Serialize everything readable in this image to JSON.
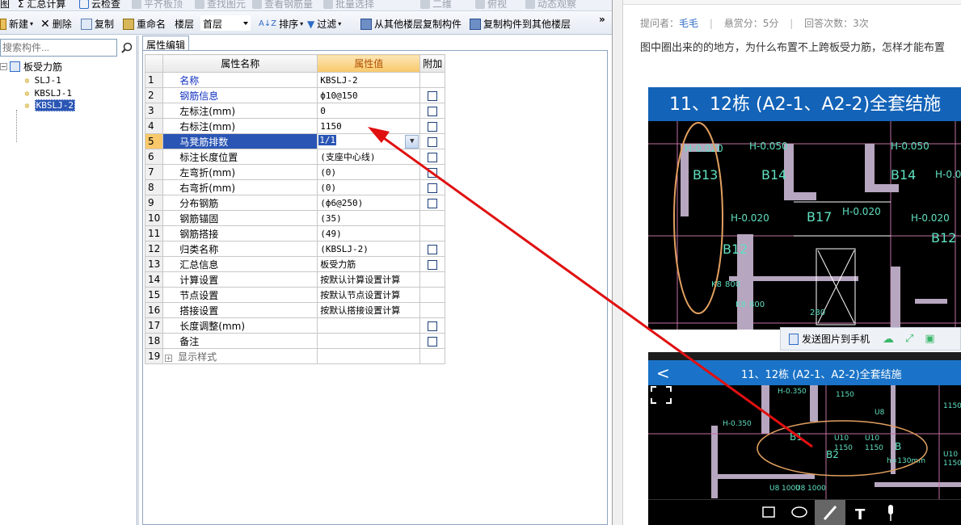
{
  "toolbar_row1": {
    "items": [
      "图",
      "Σ 汇总计算",
      "云检查",
      "平齐板顶",
      "查找图元",
      "查看钢筋量",
      "批量选择",
      "二维",
      "俯视",
      "动态观察"
    ]
  },
  "toolbar_row2": {
    "new_label": "新建",
    "delete_label": "删除",
    "copy_label": "复制",
    "rename_label": "重命名",
    "floor_label": "楼层",
    "floor_value": "首层",
    "sort_label": "排序",
    "filter_label": "过滤",
    "copy_from_label": "从其他楼层复制构件",
    "copy_to_label": "复制构件到其他楼层",
    "more": "»"
  },
  "left_panel": {
    "search_placeholder": "搜索构件...",
    "root_label": "板受力筋",
    "items": [
      "SLJ-1",
      "KBSLJ-1",
      "KBSLJ-2"
    ]
  },
  "property_panel": {
    "tab_label": "属性编辑",
    "headers": {
      "name": "属性名称",
      "value": "属性值",
      "extra": "附加"
    },
    "rows": [
      {
        "idx": "1",
        "name": "名称",
        "value": "KBSLJ-2"
      },
      {
        "idx": "2",
        "name": "钢筋信息",
        "value": "ф10@150"
      },
      {
        "idx": "3",
        "name": "左标注(mm)",
        "value": "0"
      },
      {
        "idx": "4",
        "name": "右标注(mm)",
        "value": "1150"
      },
      {
        "idx": "5",
        "name": "马凳筋排数",
        "value": "1/1"
      },
      {
        "idx": "6",
        "name": "标注长度位置",
        "value": "(支座中心线)"
      },
      {
        "idx": "7",
        "name": "左弯折(mm)",
        "value": "(0)"
      },
      {
        "idx": "8",
        "name": "右弯折(mm)",
        "value": "(0)"
      },
      {
        "idx": "9",
        "name": "分布钢筋",
        "value": "(ф6@250)"
      },
      {
        "idx": "10",
        "name": "钢筋锚固",
        "value": "(35)"
      },
      {
        "idx": "11",
        "name": "钢筋搭接",
        "value": "(49)"
      },
      {
        "idx": "12",
        "name": "归类名称",
        "value": "(KBSLJ-2)"
      },
      {
        "idx": "13",
        "name": "汇总信息",
        "value": "板受力筋"
      },
      {
        "idx": "14",
        "name": "计算设置",
        "value": "按默认计算设置计算"
      },
      {
        "idx": "15",
        "name": "节点设置",
        "value": "按默认节点设置计算"
      },
      {
        "idx": "16",
        "name": "搭接设置",
        "value": "按默认搭接设置计算"
      },
      {
        "idx": "17",
        "name": "长度调整(mm)",
        "value": ""
      },
      {
        "idx": "18",
        "name": "备注",
        "value": ""
      },
      {
        "idx": "19",
        "name": "显示样式",
        "value": ""
      }
    ]
  },
  "webpage": {
    "asker_label": "提问者：",
    "asker": "毛毛",
    "reward": "悬赏分：5分",
    "answers": "回答次数：3次",
    "question": "图中圈出来的的地方，为什么布置不上跨板受力筋，怎样才能布置",
    "image1_title": "11、12栋 (A2-1、A2-2)全套结施",
    "send_label": "发送图片到手机",
    "image2_title": "11、12栋 (A2-1、A2-2)全套结施",
    "image1_labels": [
      "H-0.020",
      "B13",
      "H-0.050",
      "B14",
      "H-0.050",
      "B14",
      "H-0.020",
      "B17",
      "H-0.020",
      "H-0.020",
      "B12",
      "H-0.020",
      "B12",
      "K8",
      "800",
      "K8",
      "800",
      "280"
    ],
    "image2_labels": [
      "H-0.350",
      "H-0.350",
      "U8",
      "1150",
      "U10",
      "1150",
      "1150",
      "B1",
      "B2",
      "U10",
      "1150",
      "B",
      "h=130mm",
      "U10",
      "1150",
      "U8",
      "1000",
      "U8",
      "1000"
    ]
  },
  "colors": {
    "accent_blue": "#2a55b4",
    "header_orange": "#f8c86a",
    "arrow_red": "#e01010",
    "web_banner": "#1363b8"
  }
}
